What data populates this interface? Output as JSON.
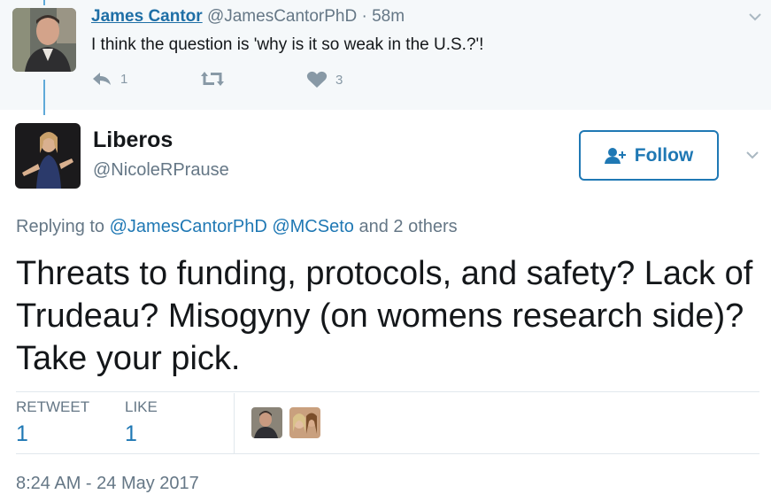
{
  "parent_tweet": {
    "name": "James Cantor",
    "handle": "@JamesCantorPhD",
    "separator": "·",
    "time": "58m",
    "text": "I think the question is 'why is it so weak in the U.S.?'!",
    "reply_count": "1",
    "like_count": "3"
  },
  "main_tweet": {
    "name": "Liberos",
    "handle": "@NicoleRPrause",
    "follow_label": "Follow",
    "replying_prefix": "Replying to",
    "mention_1": "@JamesCantorPhD",
    "mention_2": "@MCSeto",
    "replying_suffix": "and 2 others",
    "text": "Threats to funding, protocols, and safety? Lack of Trudeau? Misogyny (on womens research side)? Take your pick.",
    "retweet_label": "RETWEET",
    "retweet_count": "1",
    "like_label": "LIKE",
    "like_count": "1",
    "timestamp": "8:24 AM - 24 May 2017"
  },
  "colors": {
    "link": "#1f78b4",
    "muted": "#657786",
    "thread_line": "#5fa9d8",
    "parent_bg": "#f5f8fa"
  }
}
